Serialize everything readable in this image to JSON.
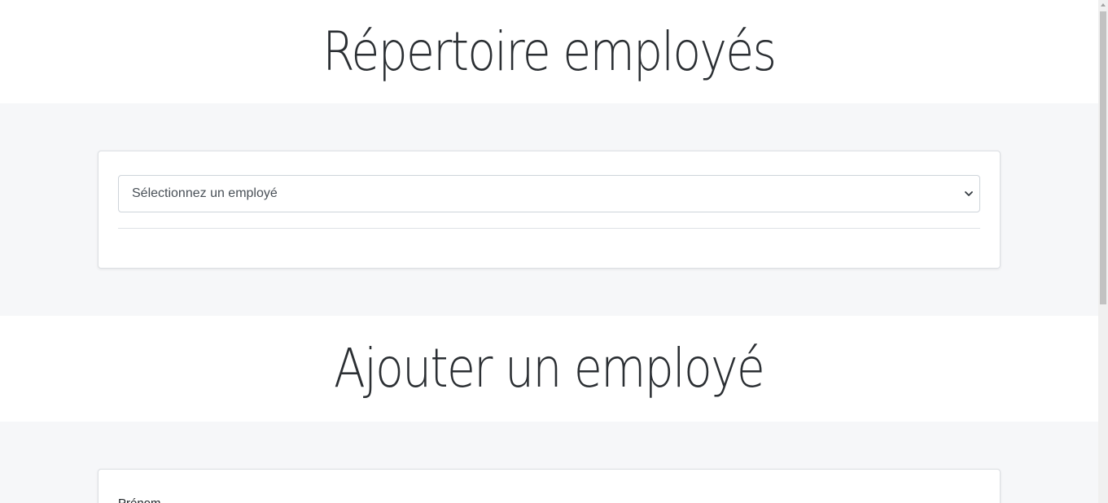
{
  "directory": {
    "title": "Répertoire employés",
    "select": {
      "placeholder": "Sélectionnez un employé"
    }
  },
  "add_employee": {
    "title": "Ajouter un employé",
    "form": {
      "first_name_label": "Prénom"
    }
  },
  "icons": {
    "select_chevron": "chevron-down-icon",
    "scroll_up": "scroll-up-arrow-icon"
  },
  "colors": {
    "band_background": "#f6f7f9",
    "card_border": "#dcdfe3",
    "heading_text": "#2b2f33"
  }
}
